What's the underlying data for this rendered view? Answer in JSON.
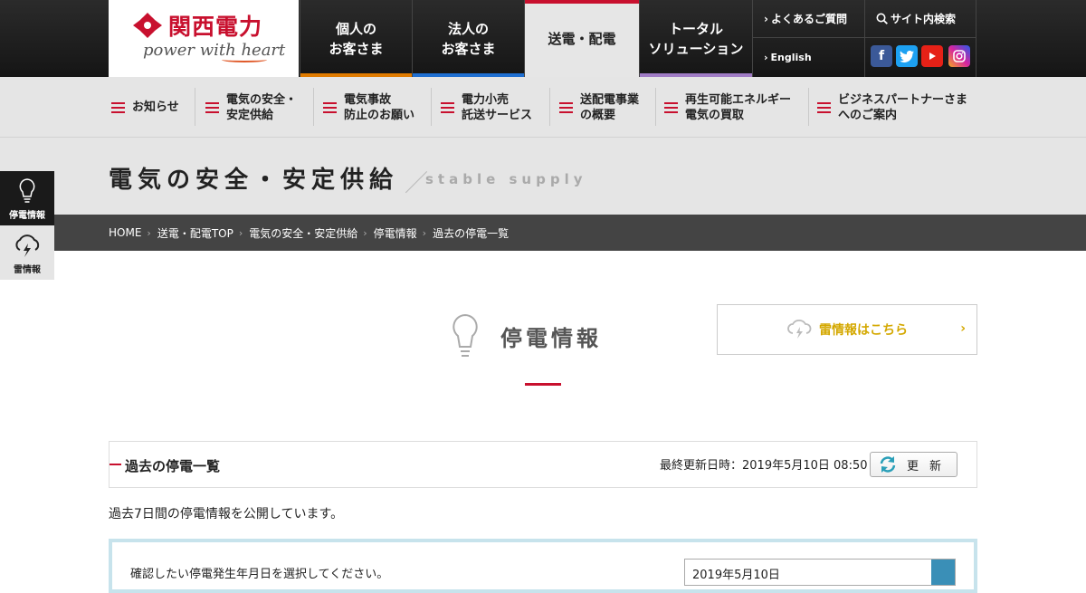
{
  "header": {
    "logo_name": "関西電力",
    "logo_tagline": "power with heart",
    "nav": [
      {
        "line1": "個人の",
        "line2": "お客さま",
        "color": "#e07b00"
      },
      {
        "line1": "法人の",
        "line2": "お客さま",
        "color": "#1f6fd1"
      },
      {
        "line1": "送電・配電",
        "line2": "",
        "color": "#c8102e"
      },
      {
        "line1": "トータル",
        "line2": "ソリューション",
        "color": "#a07cc5"
      }
    ],
    "faq": "よくあるご質問",
    "search": "サイト内検索",
    "english": "English",
    "sns": [
      {
        "icon": "facebook-icon",
        "color": "#3b5998"
      },
      {
        "icon": "twitter-icon",
        "color": "#1da1f2"
      },
      {
        "icon": "youtube-icon",
        "color": "#e62117"
      },
      {
        "icon": "instagram-icon",
        "color": "#c13584"
      }
    ]
  },
  "subnav": [
    {
      "line1": "お知らせ",
      "line2": ""
    },
    {
      "line1": "電気の安全・",
      "line2": "安定供給"
    },
    {
      "line1": "電気事故",
      "line2": "防止のお願い"
    },
    {
      "line1": "電力小売",
      "line2": "託送サービス"
    },
    {
      "line1": "送配電事業",
      "line2": "の概要"
    },
    {
      "line1": "再生可能エネルギー",
      "line2": "電気の買取"
    },
    {
      "line1": "ビジネスパートナーさま",
      "line2": "へのご案内"
    }
  ],
  "page_title": {
    "jp": "電気の安全・安定供給",
    "slash": "／",
    "en": "stable supply"
  },
  "breadcrumb": [
    "HOME",
    "送電・配電TOP",
    "電気の安全・安定供給",
    "停電情報",
    "過去の停電一覧"
  ],
  "side_tabs": {
    "outage": "停電情報",
    "thunder": "雷情報"
  },
  "section_heading": "停電情報",
  "thunder_link": "雷情報はこちら",
  "panel": {
    "title": "過去の停電一覧",
    "updated": "最終更新日時：2019年5月10日 08:50",
    "refresh": "更新"
  },
  "description": "過去7日間の停電情報を公開しています。",
  "selector": {
    "question": "確認したい停電発生年月日を選択してください。",
    "value": "2019年5月10日"
  }
}
